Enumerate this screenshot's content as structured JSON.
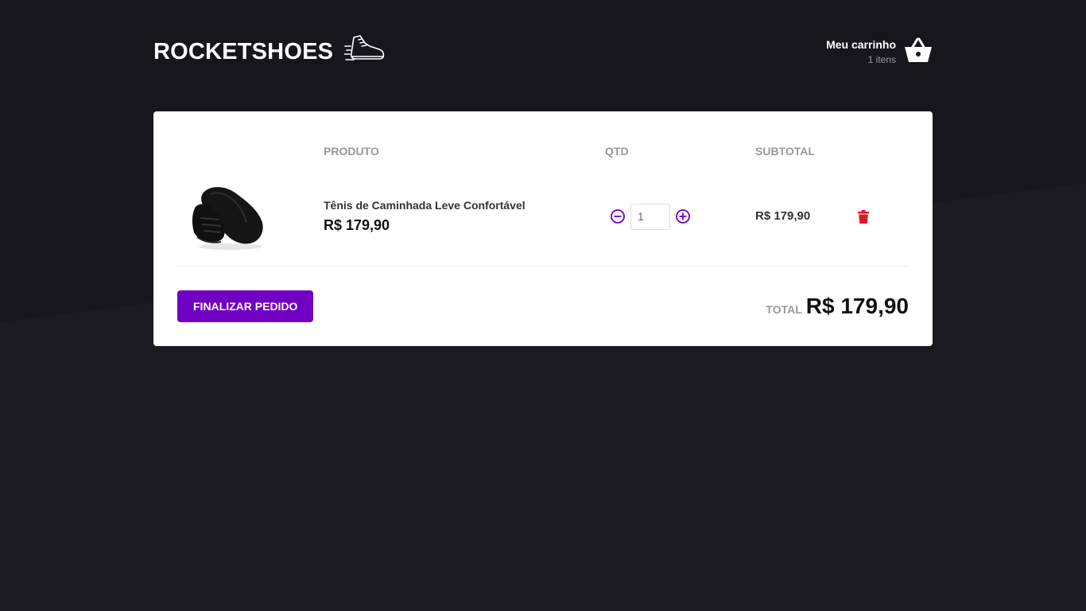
{
  "header": {
    "logo_text": "ROCKETSHOES",
    "cart_title": "Meu carrinho",
    "cart_count": "1 itens"
  },
  "table": {
    "columns": [
      "",
      "PRODUTO",
      "QTD",
      "SUBTOTAL",
      ""
    ],
    "rows": [
      {
        "title": "Tênis de Caminhada Leve Confortável",
        "price": "R$ 179,90",
        "quantity": "1",
        "subtotal": "R$ 179,90"
      }
    ]
  },
  "footer": {
    "finish_label": "FINALIZAR PEDIDO",
    "total_label": "TOTAL",
    "total_value": "R$ 179,90"
  },
  "colors": {
    "background": "#1b1a22",
    "accent": "#7100c2",
    "delete": "#e0182f"
  },
  "icons": {
    "logo": "running-shoe-icon",
    "cart": "shopping-basket-icon",
    "decrement": "minus-circle-icon",
    "increment": "plus-circle-icon",
    "delete": "trash-icon"
  }
}
